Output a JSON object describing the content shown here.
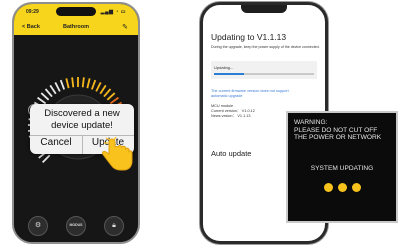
{
  "left_phone": {
    "status_time": "09:29",
    "status_icons": "▂▄▆ ◔ ▭",
    "nav": {
      "back_label": "< Back",
      "title": "Bathroom",
      "edit_icon": "pencil-icon"
    },
    "dial": {
      "plus_label": "+",
      "minus_label": "−"
    },
    "dialog": {
      "message_line1": "Discovered a new",
      "message_line2": "device update!",
      "cancel_label": "Cancel",
      "update_label": "Update"
    },
    "dock": {
      "settings_icon": "gear-icon",
      "mode_label": "MODUS",
      "lock_icon": "lock-icon"
    }
  },
  "right_phone": {
    "title": "Updating to V1.1.13",
    "subtitle": "During the upgrade, keep the power supply of the device connected.",
    "progress_label": "Updating...",
    "progress_fraction": 0.3,
    "note_line1": "The current firmware version does not support",
    "note_line2": "automatic upgrade",
    "mcu_label": "MCU module",
    "current_version": "Current version：  V1.0.12",
    "news_version": "News vesion：  V1.1.13",
    "auto_update_label": "Auto update"
  },
  "warning": {
    "line1": "WARNING:",
    "line2": "PLEASE DO NOT CUT OFF",
    "line3": "THE POWER OR NETWORK",
    "system_label": "SYSTEM UPDATING",
    "dot_color": "#f7c21c"
  },
  "colors": {
    "accent_yellow": "#f7d51c",
    "progress_blue": "#2a7fd4",
    "note_blue": "#3b7bd6"
  }
}
